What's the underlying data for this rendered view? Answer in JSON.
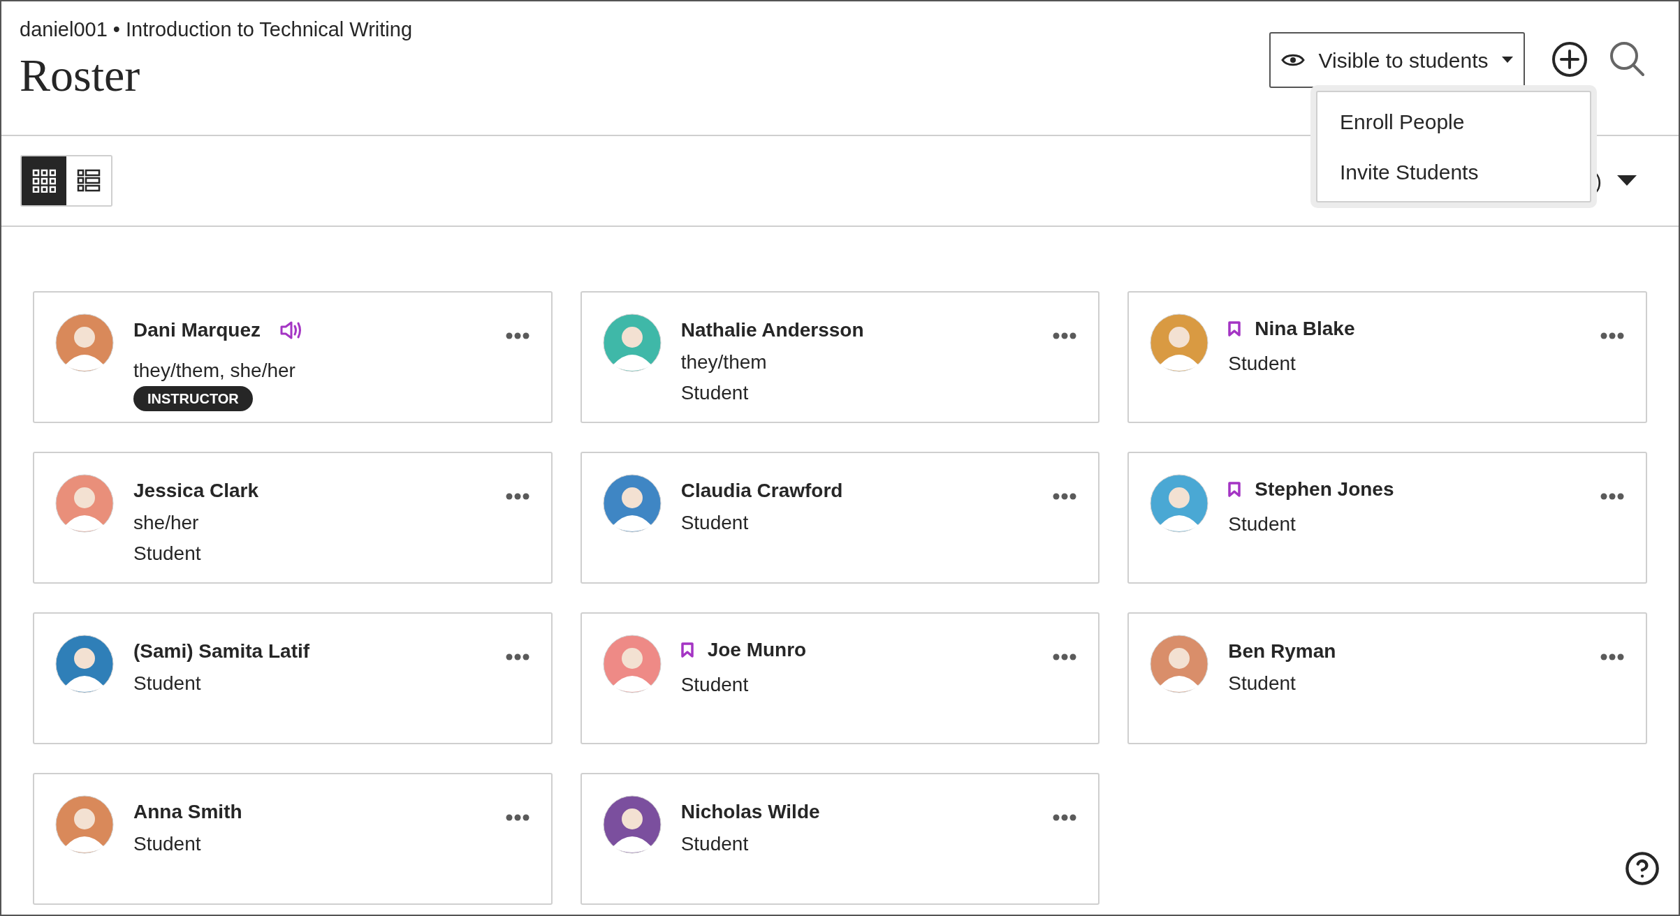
{
  "breadcrumb": "daniel001 • Introduction to Technical Writing",
  "title": "Roster",
  "visibility_button": {
    "label": "Visible to students"
  },
  "add_menu": {
    "expanded": true,
    "items": [
      "Enroll People",
      "Invite Students"
    ]
  },
  "view_toggle": [
    {
      "kind": "grid",
      "selected": true
    },
    {
      "kind": "list",
      "selected": false
    }
  ],
  "sort": {
    "label": ")"
  },
  "members": [
    {
      "kind": "audio",
      "name": "Dani Marquez",
      "pronouns": "they/them, she/her",
      "badge": "INSTRUCTOR",
      "color": "#d9895a"
    },
    {
      "kind": "plain",
      "name": "Nathalie Andersson",
      "pronouns": "they/them",
      "role": "Student",
      "color": "#3fb8a8"
    },
    {
      "kind": "bookmark",
      "name": "Nina Blake",
      "role": "Student",
      "color": "#d99a42"
    },
    {
      "kind": "plain",
      "name": "Jessica Clark",
      "pronouns": "she/her",
      "role": "Student",
      "color": "#e98f7a"
    },
    {
      "kind": "plain",
      "name": "Claudia Crawford",
      "role": "Student",
      "color": "#3f86c4"
    },
    {
      "kind": "bookmark",
      "name": "Stephen Jones",
      "role": "Student",
      "color": "#4aa8d4"
    },
    {
      "kind": "plain",
      "name": "(Sami) Samita Latif",
      "role": "Student",
      "color": "#2f7fb8"
    },
    {
      "kind": "bookmark",
      "name": "Joe Munro",
      "role": "Student",
      "color": "#ee8a86"
    },
    {
      "kind": "plain",
      "name": "Ben Ryman",
      "role": "Student",
      "color": "#d98e6a"
    },
    {
      "kind": "plain",
      "name": "Anna Smith",
      "role": "Student",
      "color": "#d9895a"
    },
    {
      "kind": "plain",
      "name": "Nicholas Wilde",
      "role": "Student",
      "color": "#7b4f9e"
    }
  ]
}
